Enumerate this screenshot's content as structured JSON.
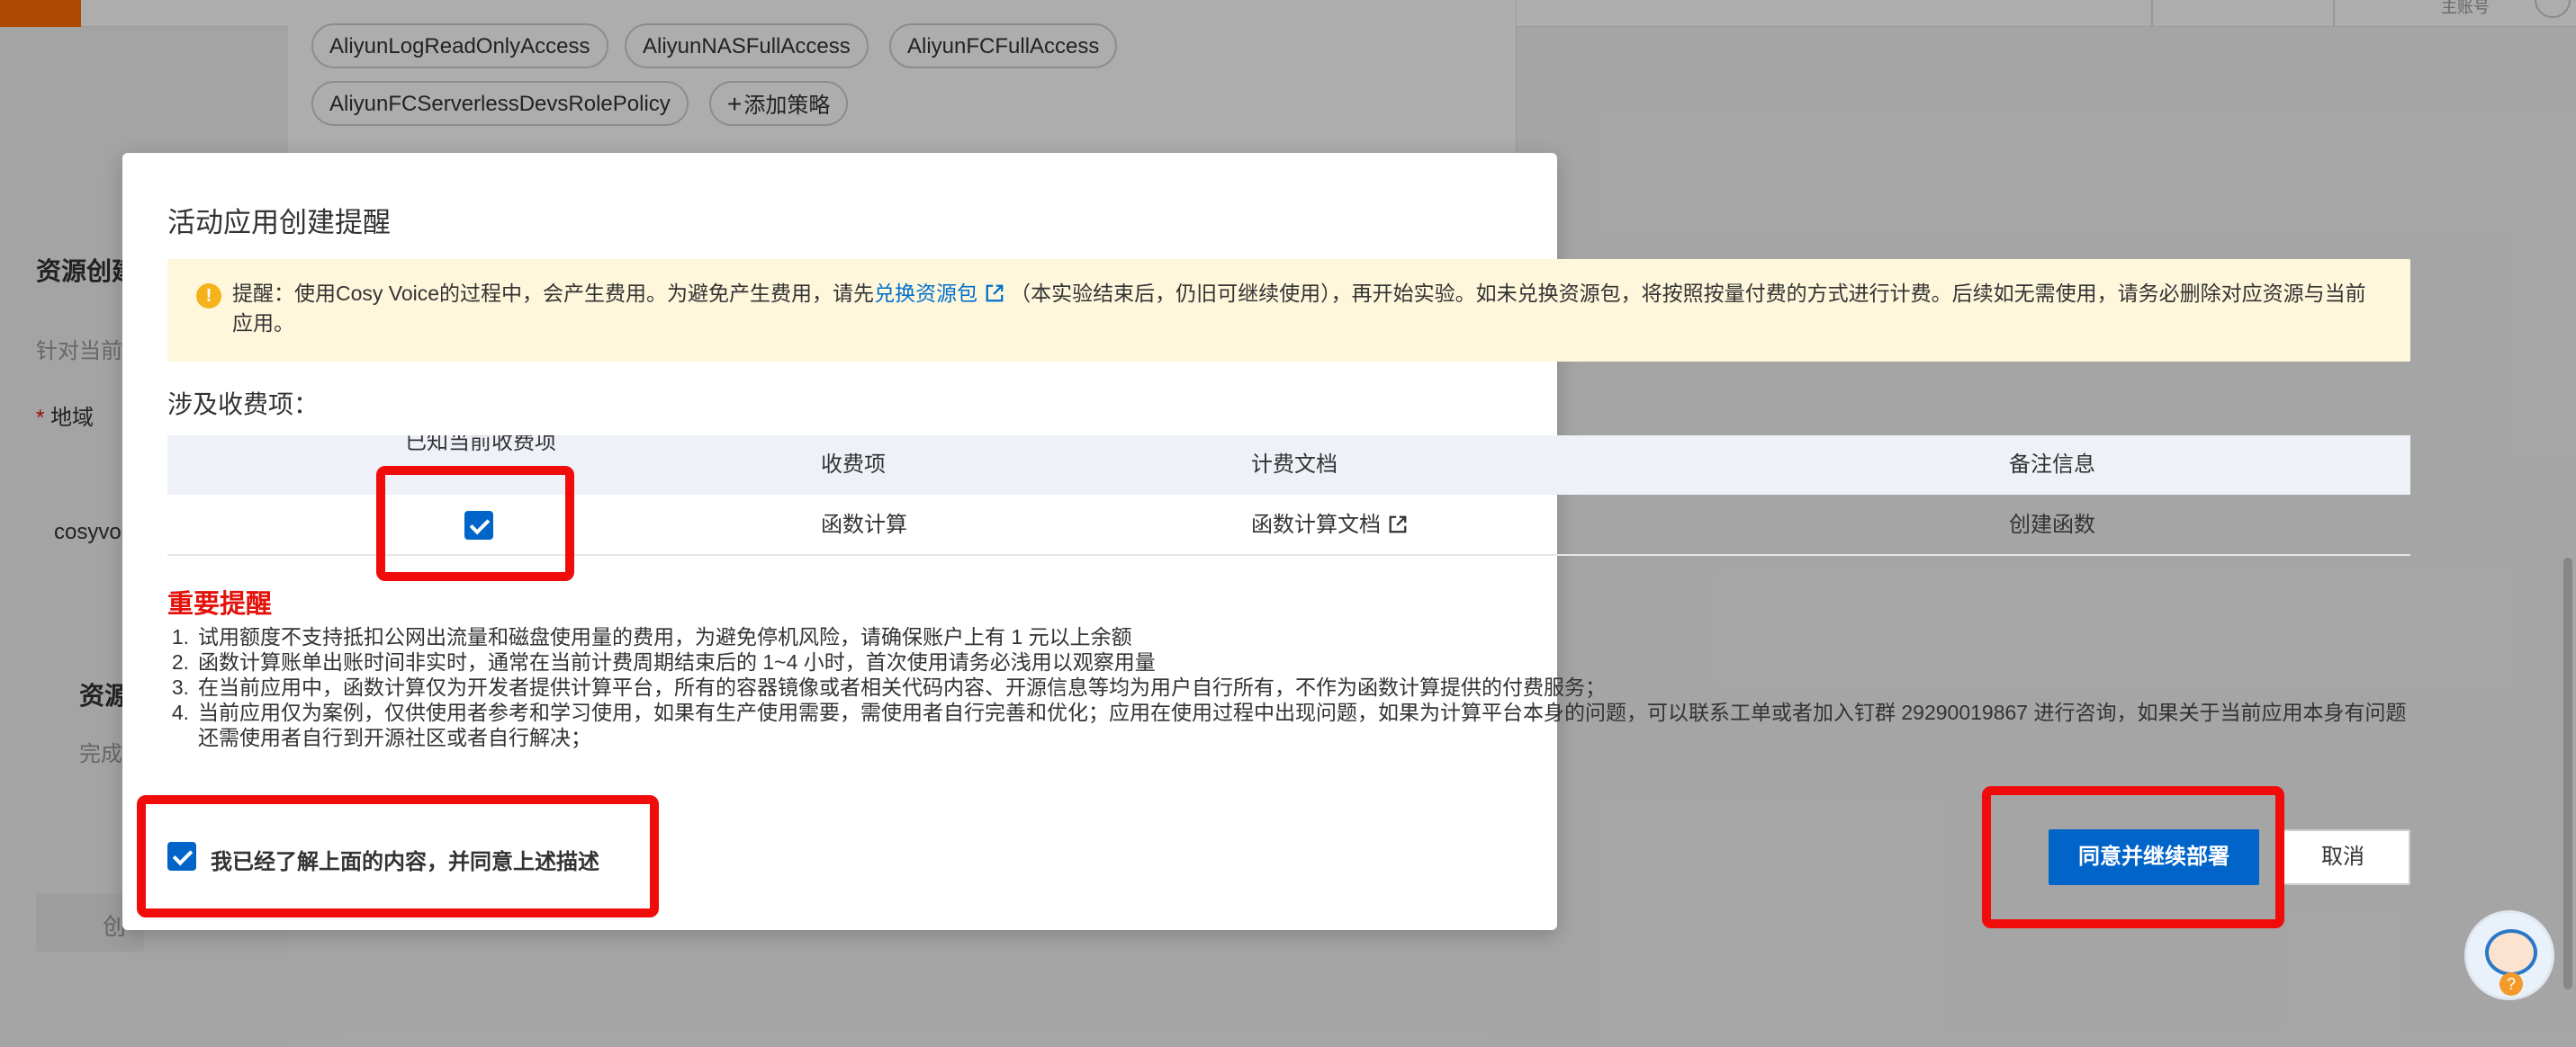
{
  "background": {
    "topbar": {
      "account_label": "主账号"
    },
    "policy_tags": [
      "AliyunLogReadOnlyAccess",
      "AliyunNASFullAccess",
      "AliyunFCFullAccess",
      "AliyunFCServerlessDevsRolePolicy"
    ],
    "add_policy_label": "添加策略",
    "side": {
      "section1_title": "资源创建",
      "section1_sub": "针对当前",
      "region_label": "地域",
      "region_value": "cosyvo",
      "section2_title": "资源",
      "section2_sub": "完成",
      "button_text": "创"
    }
  },
  "modal": {
    "title": "活动应用创建提醒",
    "notice": {
      "prefix": "提醒：使用Cosy Voice的过程中，会产生费用。为避免产生费用，请先",
      "link": "兑换资源包",
      "suffix": "（本实验结束后，仍旧可继续使用），再开始实验。如未兑换资源包，将按照按量付费的方式进行计费。后续如无需使用，请务必删除对应资源与当前应用。"
    },
    "charges_label": "涉及收费项：",
    "table": {
      "headers": [
        "已知当前收费项",
        "收费项",
        "计费文档",
        "备注信息"
      ],
      "rows": [
        {
          "checked": true,
          "item": "函数计算",
          "doc": "函数计算文档",
          "note": "创建函数"
        }
      ]
    },
    "important_title": "重要提醒",
    "important_items": [
      {
        "num": "1.",
        "text": "试用额度不支持抵扣公网出流量和磁盘使用量的费用，为避免停机风险，请确保账户上有 1 元以上余额"
      },
      {
        "num": "2.",
        "text": "函数计算账单出账时间非实时，通常在当前计费周期结束后的 1~4 小时，首次使用请务必浅用以观察用量"
      },
      {
        "num": "3.",
        "text": "在当前应用中，函数计算仅为开发者提供计算平台，所有的容器镜像或者相关代码内容、开源信息等均为用户自行所有，不作为函数计算提供的付费服务；"
      },
      {
        "num": "4.",
        "text": "当前应用仅为案例，仅供使用者参考和学习使用，如果有生产使用需要，需使用者自行完善和优化；应用在使用过程中出现问题，如果为计算平台本身的问题，可以联系工单或者加入钉群 29290019867 进行咨询，如果关于当前应用本身有问题还需使用者自行到开源社区或者自行解决；"
      }
    ],
    "agree_label": "我已经了解上面的内容，并同意上述描述",
    "agree_checked": true,
    "confirm_button": "同意并继续部署",
    "cancel_button": "取消"
  },
  "colors": {
    "primary": "#0064c8",
    "highlight": "#f10c0c",
    "warning_bg": "#fff7dc",
    "important": "#e3120b"
  },
  "icons": [
    "warning-icon",
    "external-link-icon",
    "checkbox-checked-icon",
    "assistant-avatar-icon"
  ]
}
